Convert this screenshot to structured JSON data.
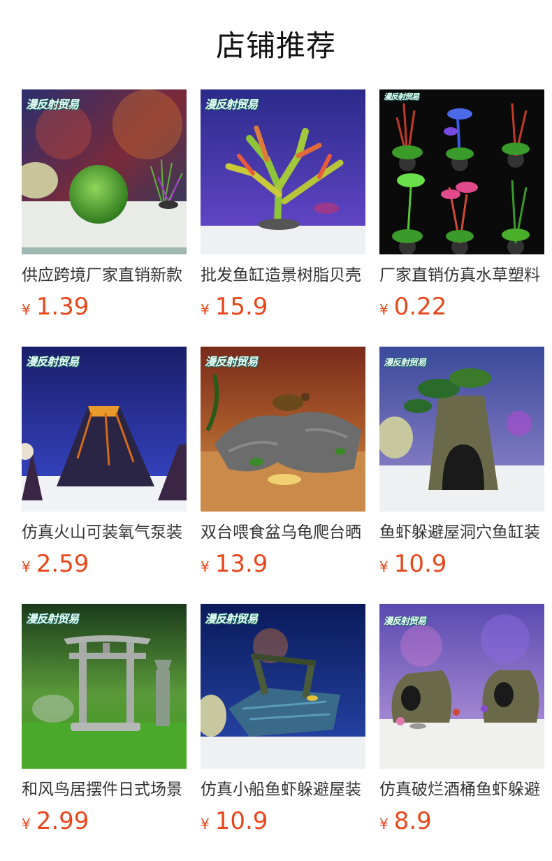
{
  "page": {
    "title": "店铺推荐"
  },
  "watermark": "漫反射贸易",
  "products": [
    {
      "name": "供应跨境厂家直销新款",
      "currency": "¥",
      "price": "1.39",
      "image": "moss-ball"
    },
    {
      "name": "批发鱼缸造景树脂贝壳",
      "currency": "¥",
      "price": "15.9",
      "image": "coral"
    },
    {
      "name": "厂家直销仿真水草塑料",
      "currency": "¥",
      "price": "0.22",
      "image": "plants"
    },
    {
      "name": "仿真火山可装氧气泵装",
      "currency": "¥",
      "price": "2.59",
      "image": "volcano"
    },
    {
      "name": "双台喂食盆乌龟爬台晒",
      "currency": "¥",
      "price": "13.9",
      "image": "turtle-rock"
    },
    {
      "name": "鱼虾躲避屋洞穴鱼缸装",
      "currency": "¥",
      "price": "10.9",
      "image": "tree-cave"
    },
    {
      "name": "和风鸟居摆件日式场景",
      "currency": "¥",
      "price": "2.99",
      "image": "torii"
    },
    {
      "name": "仿真小船鱼虾躲避屋装",
      "currency": "¥",
      "price": "10.9",
      "image": "shipwreck"
    },
    {
      "name": "仿真破烂酒桶鱼虾躲避",
      "currency": "¥",
      "price": "8.9",
      "image": "barrel"
    }
  ]
}
